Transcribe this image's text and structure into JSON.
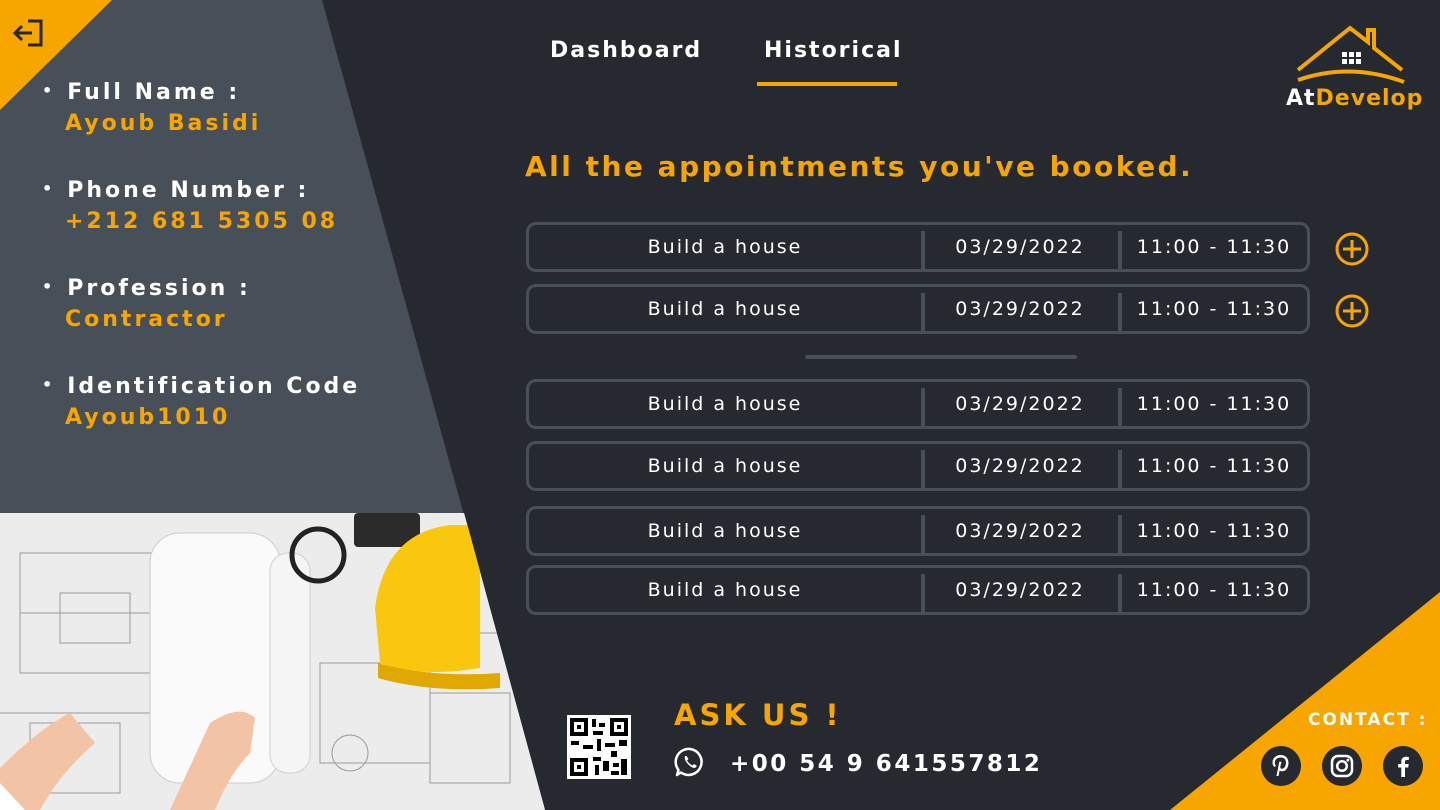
{
  "profile": {
    "items": [
      {
        "label": "Full Name :",
        "value": "Ayoub Basidi"
      },
      {
        "label": "Phone Number :",
        "value": "+212 681 5305 08"
      },
      {
        "label": "Profession :",
        "value": "Contractor"
      },
      {
        "label": "Identification Code",
        "value": "Ayoub1010"
      }
    ]
  },
  "tabs": [
    {
      "label": "Dashboard"
    },
    {
      "label": "Historical",
      "active": true
    }
  ],
  "logo": {
    "part1": "At",
    "part2": "Develop"
  },
  "main": {
    "heading": "All the appointments you've booked."
  },
  "appointments": [
    {
      "service": "Build a house",
      "date": "03/29/2022",
      "time": "11:00 - 11:30",
      "addable": true
    },
    {
      "service": "Build a house",
      "date": "03/29/2022",
      "time": "11:00 - 11:30",
      "addable": true
    },
    {
      "service": "Build a house",
      "date": "03/29/2022",
      "time": "11:00 - 11:30",
      "addable": false
    },
    {
      "service": "Build a house",
      "date": "03/29/2022",
      "time": "11:00 - 11:30",
      "addable": false
    },
    {
      "service": "Build a house",
      "date": "03/29/2022",
      "time": "11:00 - 11:30",
      "addable": false
    },
    {
      "service": "Build a house",
      "date": "03/29/2022",
      "time": "11:00 - 11:30",
      "addable": false
    }
  ],
  "footer": {
    "ask": "ASK US !",
    "phone": "+00 54 9 641557812",
    "contact_label": "CONTACT :",
    "socials": [
      "pinterest-icon",
      "instagram-icon",
      "facebook-icon"
    ]
  },
  "colors": {
    "accent": "#f7a600",
    "background": "#262a30",
    "panel": "#474f59"
  }
}
